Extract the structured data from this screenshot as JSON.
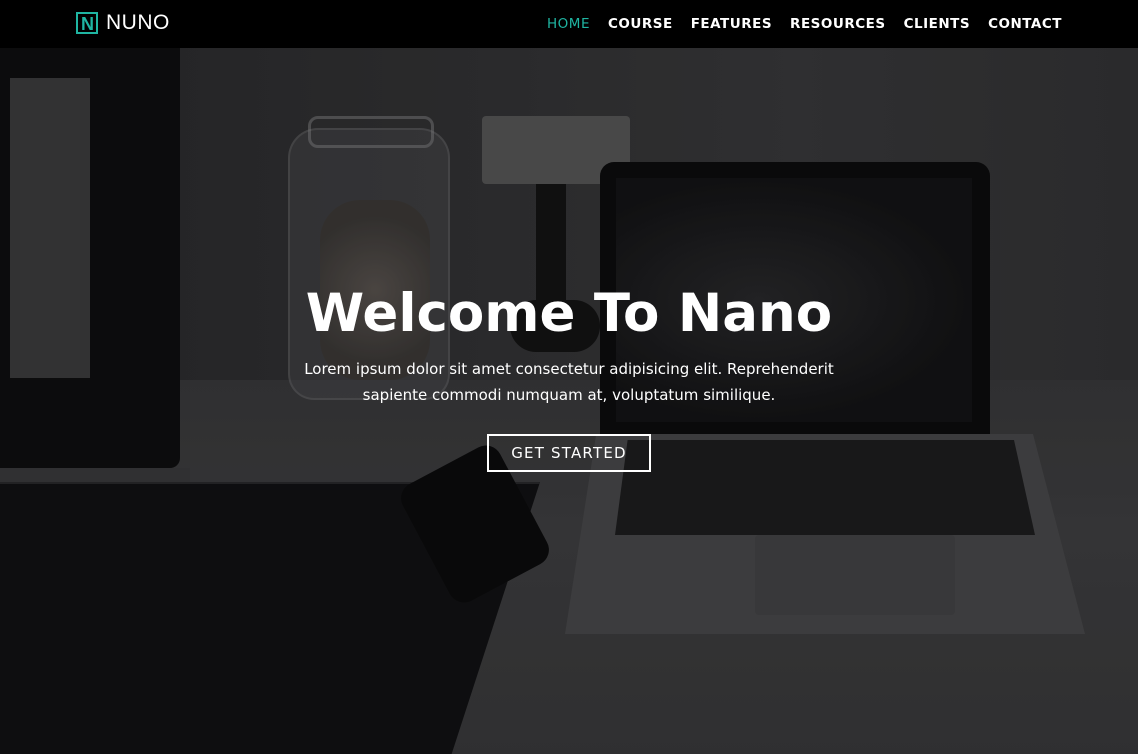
{
  "brand": {
    "logo_letter": "N",
    "name": "NUNO",
    "accent_color": "#1fb5a2"
  },
  "nav": {
    "items": [
      {
        "label": "HOME",
        "active": true
      },
      {
        "label": "COURSE",
        "active": false
      },
      {
        "label": "FEATURES",
        "active": false
      },
      {
        "label": "RESOURCES",
        "active": false
      },
      {
        "label": "CLIENTS",
        "active": false
      },
      {
        "label": "CONTACT",
        "active": false
      }
    ]
  },
  "hero": {
    "title": "Welcome To Nano",
    "subtitle": "Lorem ipsum dolor sit amet consectetur adipisicing elit. Reprehenderit sapiente commodi numquam at, voluptatum similique.",
    "cta_label": "GET STARTED"
  }
}
